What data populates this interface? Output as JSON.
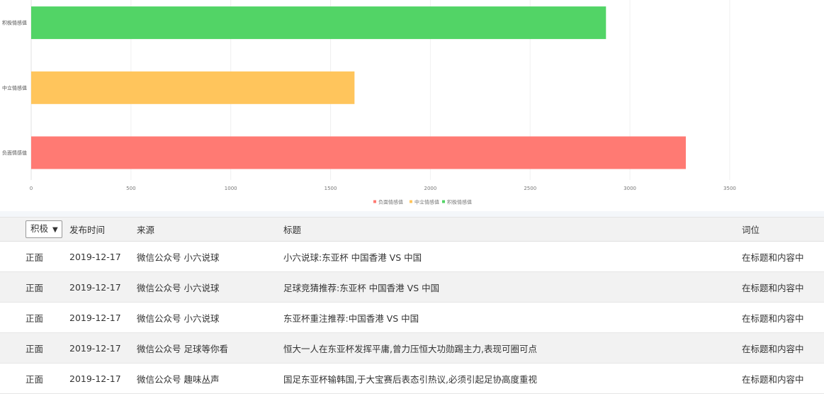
{
  "chart_data": {
    "type": "bar",
    "orientation": "horizontal",
    "categories": [
      "负面情感值",
      "中立情感值",
      "积极情感值"
    ],
    "values": [
      3280,
      1620,
      2880
    ],
    "colors": [
      "#ff7a73",
      "#ffc55c",
      "#52d466"
    ],
    "xlim": [
      0,
      4000
    ],
    "xticks": [
      0,
      500,
      1000,
      1500,
      2000,
      2500,
      3000,
      3500
    ],
    "grid": true,
    "legend": {
      "placement": "bottom-center",
      "entries": [
        "负面情感值",
        "中立情感值",
        "积极情感值"
      ]
    }
  },
  "table": {
    "filter": {
      "selected": "积极",
      "arrow": "▼"
    },
    "headers": {
      "time": "发布时间",
      "source": "来源",
      "title": "标题",
      "position": "词位"
    },
    "rows": [
      {
        "sentiment": "正面",
        "time": "2019-12-17",
        "source": "微信公众号 小六说球",
        "title": "小六说球:东亚杯 中国香港 VS 中国",
        "position": "在标题和内容中"
      },
      {
        "sentiment": "正面",
        "time": "2019-12-17",
        "source": "微信公众号 小六说球",
        "title": "足球竞猜推荐:东亚杯 中国香港 VS 中国",
        "position": "在标题和内容中"
      },
      {
        "sentiment": "正面",
        "time": "2019-12-17",
        "source": "微信公众号 小六说球",
        "title": "东亚杯重注推荐:中国香港 VS 中国",
        "position": "在标题和内容中"
      },
      {
        "sentiment": "正面",
        "time": "2019-12-17",
        "source": "微信公众号 足球等你看",
        "title": "恒大一人在东亚杯发挥平庸,曾力压恒大功勋踢主力,表现可圈可点",
        "position": "在标题和内容中"
      },
      {
        "sentiment": "正面",
        "time": "2019-12-17",
        "source": "微信公众号 趣味丛声",
        "title": "国足东亚杯输韩国,于大宝赛后表态引热议,必须引起足协高度重视",
        "position": "在标题和内容中"
      }
    ]
  }
}
